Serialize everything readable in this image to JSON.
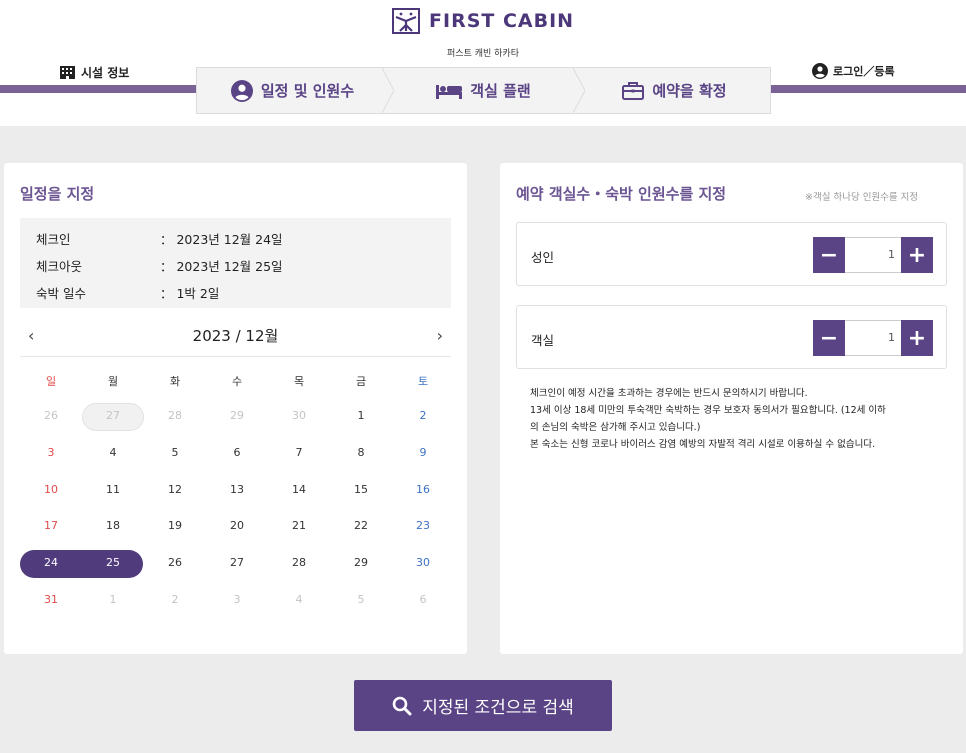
{
  "brand": {
    "name": "FIRST CABIN",
    "subtitle": "퍼스트 캐빈 하카타",
    "accent": "#5a4486",
    "bar_color": "#7a6296"
  },
  "header": {
    "facility_label": "시설 정보",
    "facility_icon": "building-icon",
    "login_label": "로그인／등록",
    "login_icon": "user-circle-icon"
  },
  "steps": [
    {
      "label": "일정 및 인원수",
      "icon": "user-circle-icon",
      "active": true
    },
    {
      "label": "객실 플랜",
      "icon": "bed-icon",
      "active": false
    },
    {
      "label": "예약을 확정",
      "icon": "briefcase-icon",
      "active": false
    }
  ],
  "schedule": {
    "title": "일정을 지정",
    "rows": [
      {
        "label": "체크인",
        "value": "：  2023년 12월 24일"
      },
      {
        "label": "체크아웃",
        "value": "：  2023년 12월 25일"
      },
      {
        "label": "숙박 일수",
        "value": "：  1박 2일"
      }
    ],
    "calendar": {
      "prev": "‹",
      "next": "›",
      "month_label": "2023  / 12월",
      "weekdays": [
        "일",
        "월",
        "화",
        "수",
        "목",
        "금",
        "토"
      ],
      "weeks": [
        [
          "26",
          "27",
          "28",
          "29",
          "30",
          "1",
          "2"
        ],
        [
          "3",
          "4",
          "5",
          "6",
          "7",
          "8",
          "9"
        ],
        [
          "10",
          "11",
          "12",
          "13",
          "14",
          "15",
          "16"
        ],
        [
          "17",
          "18",
          "19",
          "20",
          "21",
          "22",
          "23"
        ],
        [
          "24",
          "25",
          "26",
          "27",
          "28",
          "29",
          "30"
        ],
        [
          "31",
          "1",
          "2",
          "3",
          "4",
          "5",
          "6"
        ]
      ],
      "selected": [
        "24",
        "25"
      ]
    }
  },
  "occupancy": {
    "title": "예약 객실수・숙박 인원수를 지정",
    "note": "※객실 하나당 인원수를 지정",
    "counters": [
      {
        "label": "성인",
        "value": "1",
        "minus": "−",
        "plus": "+"
      },
      {
        "label": "객실",
        "value": "1",
        "minus": "−",
        "plus": "+"
      }
    ],
    "notes": [
      "체크인이 예정 시간을 초과하는 경우에는 반드시 문의하시기 바랍니다.",
      "13세 이상 18세 미만의 투숙객만 숙박하는 경우 보호자 동의서가 필요합니다. (12세 이하",
      "의 손님의 숙박은 삼가해 주시고 있습니다.)",
      "본 숙소는 신형 코로나 바이러스 감염 예방의 자발적 격리 시설로 이용하실 수 없습니다."
    ]
  },
  "search": {
    "label": "지정된 조건으로 검색",
    "icon": "search-icon"
  }
}
